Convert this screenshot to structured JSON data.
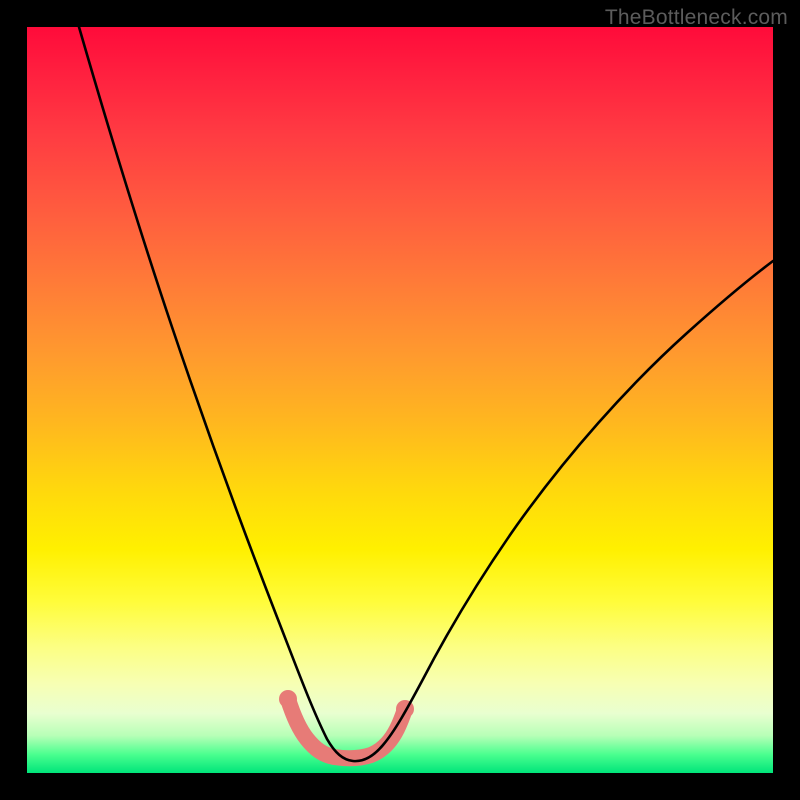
{
  "watermark": "TheBottleneck.com",
  "chart_data": {
    "type": "line",
    "title": "",
    "xlabel": "",
    "ylabel": "",
    "xlim": [
      0,
      100
    ],
    "ylim": [
      0,
      100
    ],
    "series": [
      {
        "name": "black-curve",
        "x": [
          7,
          10,
          14,
          18,
          22,
          26,
          30,
          33,
          35,
          37,
          38.5,
          40,
          41.5,
          43,
          44.5,
          46,
          48,
          50,
          53,
          57,
          62,
          68,
          75,
          83,
          92,
          100
        ],
        "y": [
          100,
          90,
          79,
          68,
          57,
          46,
          35,
          25,
          18,
          12,
          8,
          5,
          3,
          2,
          2,
          2.5,
          3.5,
          5,
          8,
          13,
          20,
          28,
          37,
          46,
          55,
          62
        ]
      },
      {
        "name": "highlight-band",
        "x": [
          35,
          36.5,
          38,
          39.5,
          41,
          42.5,
          44,
          45.5,
          47,
          48.5,
          50
        ],
        "y": [
          10,
          7,
          5,
          3.5,
          2.5,
          2,
          2.3,
          2.8,
          3.7,
          5,
          7.5
        ]
      }
    ],
    "colors": {
      "curve": "#000000",
      "highlight": "#e77b77",
      "gradient_top": "#ff0b3a",
      "gradient_mid": "#fff000",
      "gradient_bottom": "#00e57a",
      "frame": "#000000",
      "watermark": "#5c5c5c"
    }
  }
}
